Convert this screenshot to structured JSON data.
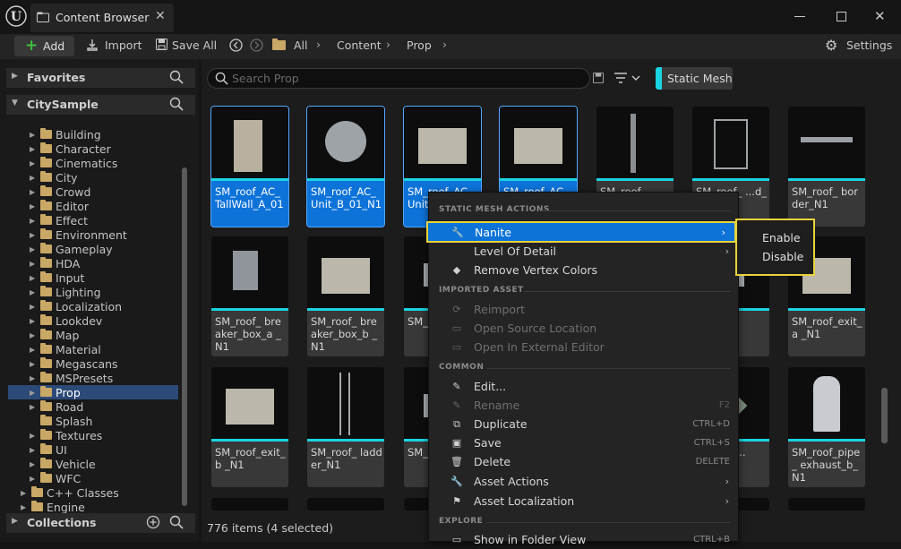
{
  "window": {
    "tab_title": "Content Browser"
  },
  "toolbar": {
    "add_label": "Add",
    "import_label": "Import",
    "save_all_label": "Save All",
    "breadcrumb": [
      "All",
      "Content",
      "Prop"
    ],
    "settings_label": "Settings"
  },
  "sidebar": {
    "favorites_label": "Favorites",
    "root_label": "CitySample",
    "items": [
      "Building",
      "Character",
      "Cinematics",
      "City",
      "Crowd",
      "Editor",
      "Effect",
      "Environment",
      "Gameplay",
      "HDA",
      "Input",
      "Lighting",
      "Localization",
      "Lookdev",
      "Map",
      "Material",
      "Megascans",
      "MSPresets",
      "Prop",
      "Road",
      "Splash",
      "Textures",
      "UI",
      "Vehicle",
      "WFC"
    ],
    "selected": "Prop",
    "cpp_classes_label": "C++ Classes",
    "engine_label": "Engine",
    "collections_label": "Collections"
  },
  "content": {
    "search_placeholder": "Search Prop",
    "filter_label": "Static Mesh",
    "status": "776 items (4 selected)",
    "assets_row1": [
      "SM_roof_AC_ TallWall_A_01",
      "SM_roof_AC_ Unit_B_01_N1",
      "SM_roof_AC_ Unit_...N1",
      "SM_roof_AC_ ...",
      "SM_roof_ ...",
      "SM_roof_ ...d_N1",
      "SM_roof_ border_N1"
    ],
    "assets_row2": [
      "SM_roof_ breaker_box_a _N1",
      "SM_roof_ breaker_box_b _N1",
      "SM_r... N1",
      "",
      "",
      "...a_N1",
      "SM_roof_exit_a _N1"
    ],
    "assets_row3": [
      "SM_roof_exit_b _N1",
      "SM_roof_ ladder_N1",
      "SM_r... a_N1",
      "",
      "",
      "..._Pipe ...",
      "SM_roof_pipe_ exhaust_b_N1"
    ]
  },
  "context_menu": {
    "sections": {
      "static_mesh": "STATIC MESH ACTIONS",
      "imported": "IMPORTED ASSET",
      "common": "COMMON",
      "explore": "EXPLORE"
    },
    "nanite": "Nanite",
    "level_of_detail": "Level Of Detail",
    "remove_vertex_colors": "Remove Vertex Colors",
    "reimport": "Reimport",
    "open_source_location": "Open Source Location",
    "open_external_editor": "Open In External Editor",
    "edit": "Edit...",
    "rename": "Rename",
    "rename_sc": "F2",
    "duplicate": "Duplicate",
    "duplicate_sc": "CTRL+D",
    "save": "Save",
    "save_sc": "CTRL+S",
    "delete": "Delete",
    "delete_sc": "DELETE",
    "asset_actions": "Asset Actions",
    "asset_localization": "Asset Localization",
    "show_in_folder": "Show in Folder View",
    "show_in_folder_sc": "CTRL+B"
  },
  "nanite_submenu": {
    "enable": "Enable",
    "disable": "Disable"
  },
  "colors": {
    "accent": "#0e73d9",
    "highlight": "#e8d33b",
    "filter_bar": "#19d4e0"
  }
}
